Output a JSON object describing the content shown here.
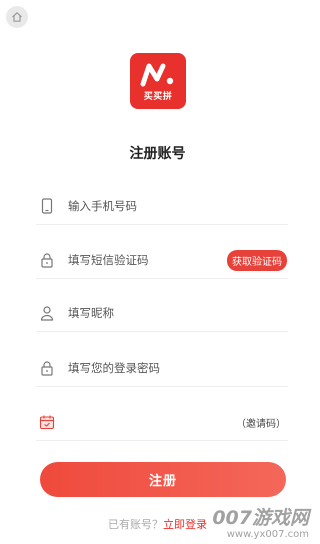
{
  "app": {
    "logo_text": "买买拼",
    "colors": {
      "brand": "#e8302d",
      "button_gradient_start": "#ef4a3c",
      "button_gradient_end": "#f4675a"
    }
  },
  "header": {
    "home_icon": "home-icon"
  },
  "page": {
    "title": "注册账号"
  },
  "form": {
    "phone": {
      "placeholder": "输入手机号码",
      "value": "",
      "icon": "phone-icon"
    },
    "sms_code": {
      "placeholder": "填写短信验证码",
      "value": "",
      "icon": "lock-icon",
      "button_label": "获取验证码"
    },
    "nickname": {
      "placeholder": "填写昵称",
      "value": "",
      "icon": "user-icon"
    },
    "password": {
      "placeholder": "填写您的登录密码",
      "value": "",
      "icon": "lock-icon"
    },
    "invite": {
      "placeholder": "",
      "value": "",
      "icon": "invite-calendar-icon",
      "label": "（邀请码）"
    },
    "submit_label": "注册"
  },
  "footer": {
    "question": "已有账号？",
    "login_link": "立即登录"
  },
  "watermark": {
    "main": "007游戏网",
    "url": "www.yx007.com"
  }
}
